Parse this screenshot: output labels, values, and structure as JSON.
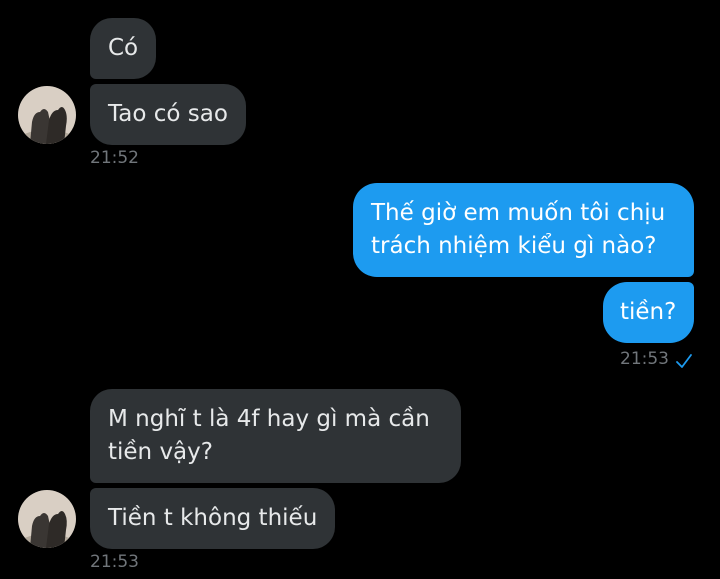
{
  "conversation": {
    "group1": {
      "messages": [
        "Có",
        "Tao có sao"
      ],
      "time": "21:52"
    },
    "group2": {
      "messages": [
        "Thế giờ em muốn tôi chịu",
        "trách nhiệm kiểu gì nào?",
        "tiền?"
      ],
      "time": "21:53",
      "status_icon": "check-icon"
    },
    "group3": {
      "messages": [
        "M nghĩ t là 4f hay gì mà cần",
        "tiền vậy?",
        "Tiền t không thiếu"
      ],
      "time": "21:53"
    }
  },
  "colors": {
    "background": "#000000",
    "incoming_bubble": "#2f3336",
    "outgoing_bubble": "#1d9bf0",
    "timestamp": "#71767b",
    "check": "#1d9bf0"
  }
}
